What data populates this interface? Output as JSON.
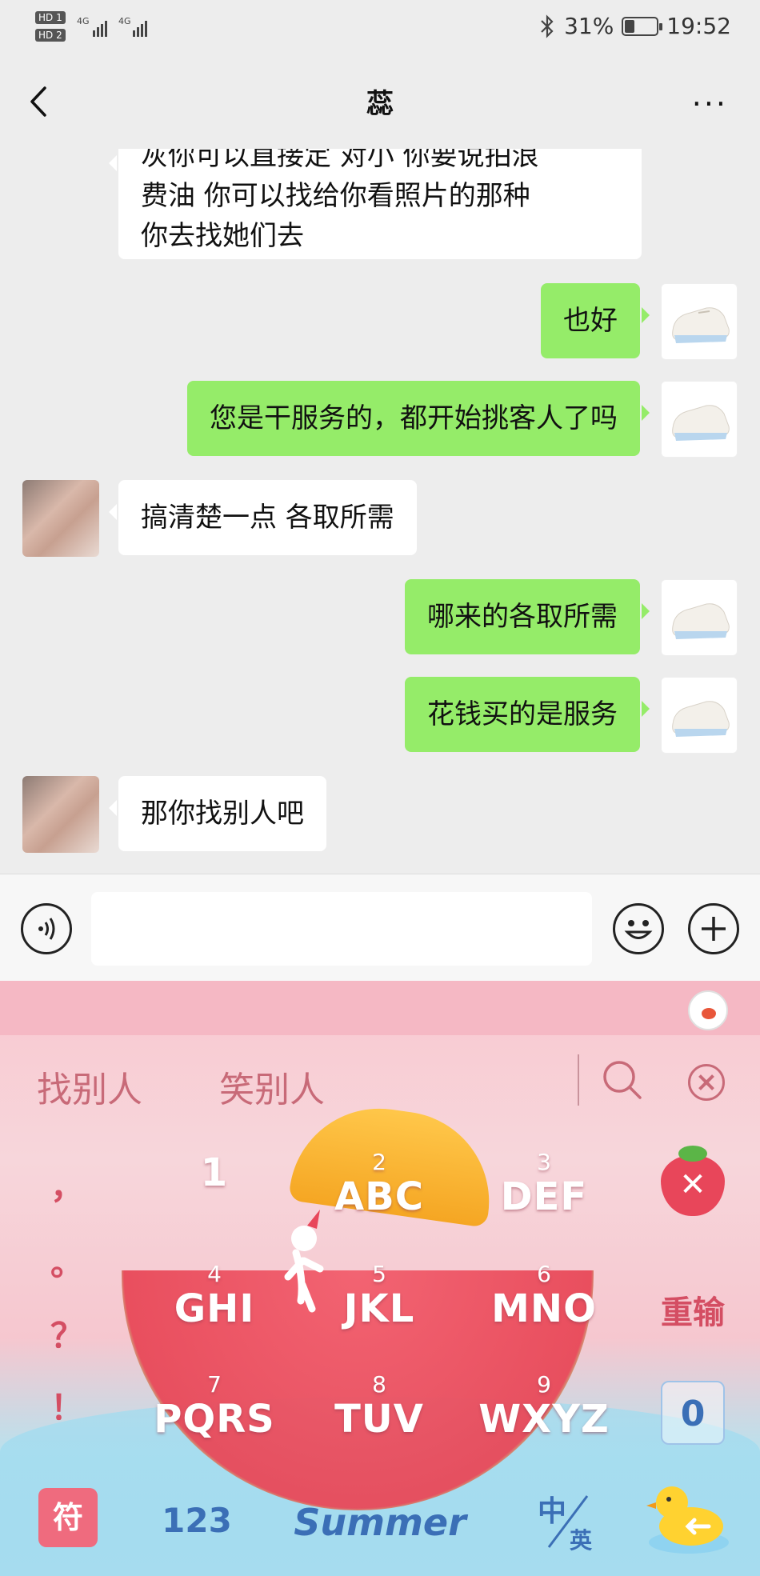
{
  "status_bar": {
    "sim1": "HD 1",
    "sim2": "HD 2",
    "network1": "4G",
    "network2": "4G",
    "battery_text": "31%",
    "battery_level": 0.31,
    "time": "19:52",
    "bluetooth_icon": "bluetooth-icon"
  },
  "header": {
    "title": "蕊",
    "back_icon": "chevron-left-icon",
    "more_icon": "more-icon",
    "more_label": "···"
  },
  "messages": [
    {
      "side": "in",
      "lines": [
        "灰你可以直接定 对小 你要说拍浪",
        "费油 你可以找给你看照片的那种",
        "你去找她们去"
      ]
    },
    {
      "side": "out",
      "text": "也好"
    },
    {
      "side": "out",
      "text": "您是干服务的，都开始挑客人了吗"
    },
    {
      "side": "in",
      "text": "搞清楚一点 各取所需"
    },
    {
      "side": "out",
      "text": "哪来的各取所需"
    },
    {
      "side": "out",
      "text": "花钱买的是服务"
    },
    {
      "side": "in",
      "text": "那你找别人吧"
    }
  ],
  "input_bar": {
    "voice_icon": "voice-icon",
    "emoji_icon": "emoji-icon",
    "plus_icon": "plus-icon",
    "text_value": ""
  },
  "keyboard": {
    "candidates": [
      "找别人",
      "笑别人"
    ],
    "punctuation": [
      "，",
      "。",
      "？",
      "！"
    ],
    "keys": [
      {
        "num": "",
        "label": "1"
      },
      {
        "num": "2",
        "label": "ABC"
      },
      {
        "num": "3",
        "label": "DEF"
      },
      {
        "num": "4",
        "label": "GHI"
      },
      {
        "num": "5",
        "label": "JKL"
      },
      {
        "num": "6",
        "label": "MNO"
      },
      {
        "num": "7",
        "label": "PQRS"
      },
      {
        "num": "8",
        "label": "TUV"
      },
      {
        "num": "9",
        "label": "WXYZ"
      }
    ],
    "delete_label": "✕",
    "reset_label": "重输",
    "zero_label": "0",
    "symbol_label": "符",
    "numbers_label": "123",
    "space_label": "Summer",
    "lang_zh": "中",
    "lang_en": "英",
    "enter_icon": "enter-icon"
  }
}
